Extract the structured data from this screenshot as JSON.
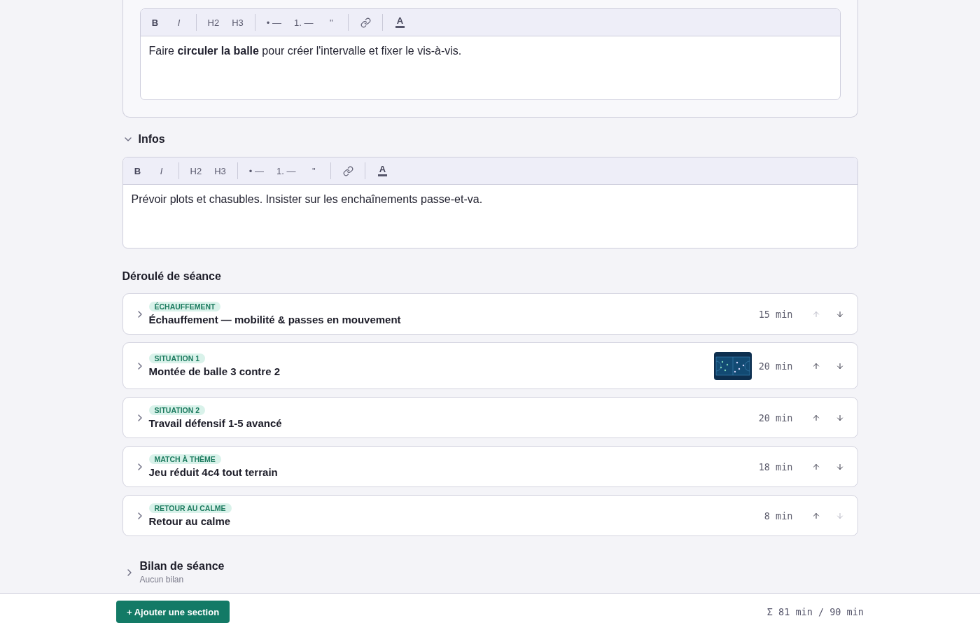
{
  "objective": {
    "editor": {
      "toolbar": [
        {
          "kind": "bold",
          "label": "B"
        },
        {
          "kind": "italic",
          "label": "I"
        },
        {
          "kind": "divider"
        },
        {
          "kind": "heading",
          "label": "H2"
        },
        {
          "kind": "heading",
          "label": "H3"
        },
        {
          "kind": "divider"
        },
        {
          "kind": "list",
          "label": "• —"
        },
        {
          "kind": "list",
          "label": "1. —"
        },
        {
          "kind": "quote",
          "label": "\""
        },
        {
          "kind": "divider"
        },
        {
          "kind": "link"
        },
        {
          "kind": "divider"
        },
        {
          "kind": "color",
          "label": "A"
        }
      ],
      "content": "Faire **circuler la balle** pour créer l'intervalle et fixer le vis-à-vis."
    }
  },
  "infos": {
    "title": "Infos",
    "expanded": true,
    "editor": {
      "toolbar": [
        {
          "kind": "bold",
          "label": "B"
        },
        {
          "kind": "italic",
          "label": "I"
        },
        {
          "kind": "divider"
        },
        {
          "kind": "heading",
          "label": "H2"
        },
        {
          "kind": "heading",
          "label": "H3"
        },
        {
          "kind": "divider"
        },
        {
          "kind": "list",
          "label": "• —"
        },
        {
          "kind": "list",
          "label": "1. —"
        },
        {
          "kind": "quote",
          "label": "\""
        },
        {
          "kind": "divider"
        },
        {
          "kind": "link"
        },
        {
          "kind": "divider"
        },
        {
          "kind": "color",
          "label": "A"
        }
      ],
      "content": "Prévoir plots et chasubles. Insister sur les enchaînements passe-et-va."
    }
  },
  "session_plan": {
    "title": "Déroulé de séance",
    "sections": [
      {
        "tag": "ÉCHAUFFEMENT",
        "title": "Échauffement — mobilité & passes en mouvement",
        "duration": "15 min",
        "expanded": false,
        "thumbnail": false,
        "up_disabled": true,
        "down_disabled": false
      },
      {
        "tag": "SITUATION 1",
        "title": "Montée de balle 3 contre 2",
        "duration": "20 min",
        "expanded": false,
        "thumbnail": true,
        "up_disabled": false,
        "down_disabled": false
      },
      {
        "tag": "SITUATION 2",
        "title": "Travail défensif 1-5 avancé",
        "duration": "20 min",
        "expanded": false,
        "thumbnail": false,
        "up_disabled": false,
        "down_disabled": false
      },
      {
        "tag": "MATCH À THÈME",
        "title": "Jeu réduit 4c4 tout terrain",
        "duration": "18 min",
        "expanded": false,
        "thumbnail": false,
        "up_disabled": false,
        "down_disabled": false
      },
      {
        "tag": "RETOUR AU CALME",
        "title": "Retour au calme",
        "duration": "8 min",
        "expanded": false,
        "thumbnail": false,
        "up_disabled": false,
        "down_disabled": true
      }
    ]
  },
  "review": {
    "title": "Bilan de séance",
    "subtitle": "Aucun bilan",
    "expanded": false
  },
  "footer": {
    "add_button": "+ Ajouter une section",
    "total": "Σ 81 min / 90 min"
  }
}
